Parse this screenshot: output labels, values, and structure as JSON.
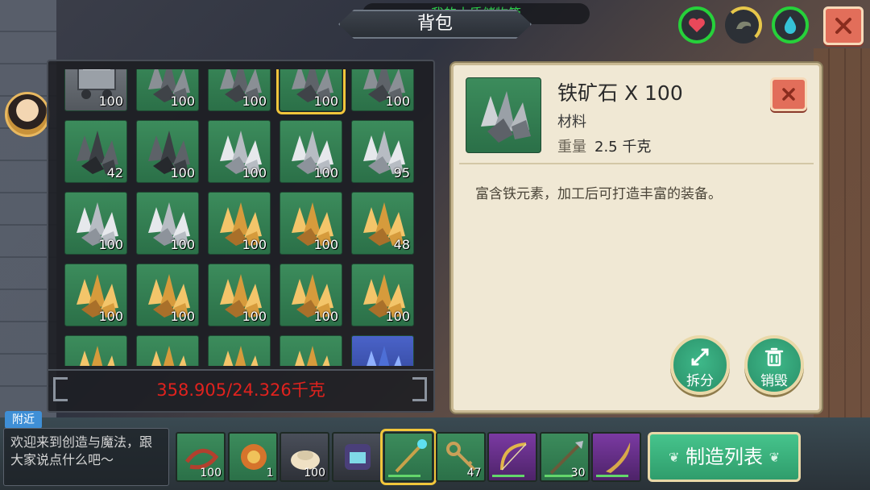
{
  "header": {
    "storage_name": "我的木质储物箱",
    "title": "背包"
  },
  "inventory": {
    "slots": [
      {
        "kind": "cart",
        "qty": "100"
      },
      {
        "kind": "iron",
        "qty": "100"
      },
      {
        "kind": "iron",
        "qty": "100"
      },
      {
        "kind": "iron",
        "qty": "100",
        "selected": true
      },
      {
        "kind": "iron",
        "qty": "100"
      },
      {
        "kind": "coal",
        "qty": "42"
      },
      {
        "kind": "coal",
        "qty": "100"
      },
      {
        "kind": "silver",
        "qty": "100"
      },
      {
        "kind": "silver",
        "qty": "100"
      },
      {
        "kind": "silver",
        "qty": "95"
      },
      {
        "kind": "silver",
        "qty": "100"
      },
      {
        "kind": "silver",
        "qty": "100"
      },
      {
        "kind": "gold",
        "qty": "100"
      },
      {
        "kind": "gold",
        "qty": "100"
      },
      {
        "kind": "gold",
        "qty": "48"
      },
      {
        "kind": "gold",
        "qty": "100"
      },
      {
        "kind": "gold",
        "qty": "100"
      },
      {
        "kind": "gold",
        "qty": "100"
      },
      {
        "kind": "gold",
        "qty": "100"
      },
      {
        "kind": "gold",
        "qty": "100"
      },
      {
        "kind": "gold",
        "qty": ""
      },
      {
        "kind": "gold",
        "qty": ""
      },
      {
        "kind": "gold",
        "qty": ""
      },
      {
        "kind": "gold",
        "qty": ""
      },
      {
        "kind": "blue",
        "qty": ""
      }
    ],
    "weight": "358.905/24.326千克"
  },
  "detail": {
    "name": "铁矿石 X 100",
    "category": "材料",
    "weight_label": "重量",
    "weight_value": "2.5 千克",
    "description": "富含铁元素，加工后可打造丰富的装备。",
    "split_label": "拆分",
    "destroy_label": "销毁"
  },
  "chat": {
    "tab": "附近",
    "message": "欢迎来到创造与魔法，跟大家说点什么吧～"
  },
  "hotbar": {
    "slots": [
      {
        "icon": "rope-icon",
        "qty": "100",
        "style": "green"
      },
      {
        "icon": "meat-icon",
        "qty": "1",
        "style": "green"
      },
      {
        "icon": "bun-icon",
        "qty": "100",
        "style": "dark"
      },
      {
        "icon": "backpack-icon",
        "qty": "",
        "style": "dark"
      },
      {
        "icon": "staff-icon",
        "qty": "",
        "style": "green",
        "selected": true
      },
      {
        "icon": "keys-icon",
        "qty": "47",
        "style": "green"
      },
      {
        "icon": "bow-icon",
        "qty": "",
        "style": "purple"
      },
      {
        "icon": "spear-icon",
        "qty": "30",
        "style": "green"
      },
      {
        "icon": "blade-icon",
        "qty": "",
        "style": "purple"
      }
    ],
    "craft_label": "制造列表"
  },
  "colors": {
    "accent_green": "#2bd34a",
    "weight_red": "#e0221e",
    "selection_gold": "#f1c63b"
  }
}
